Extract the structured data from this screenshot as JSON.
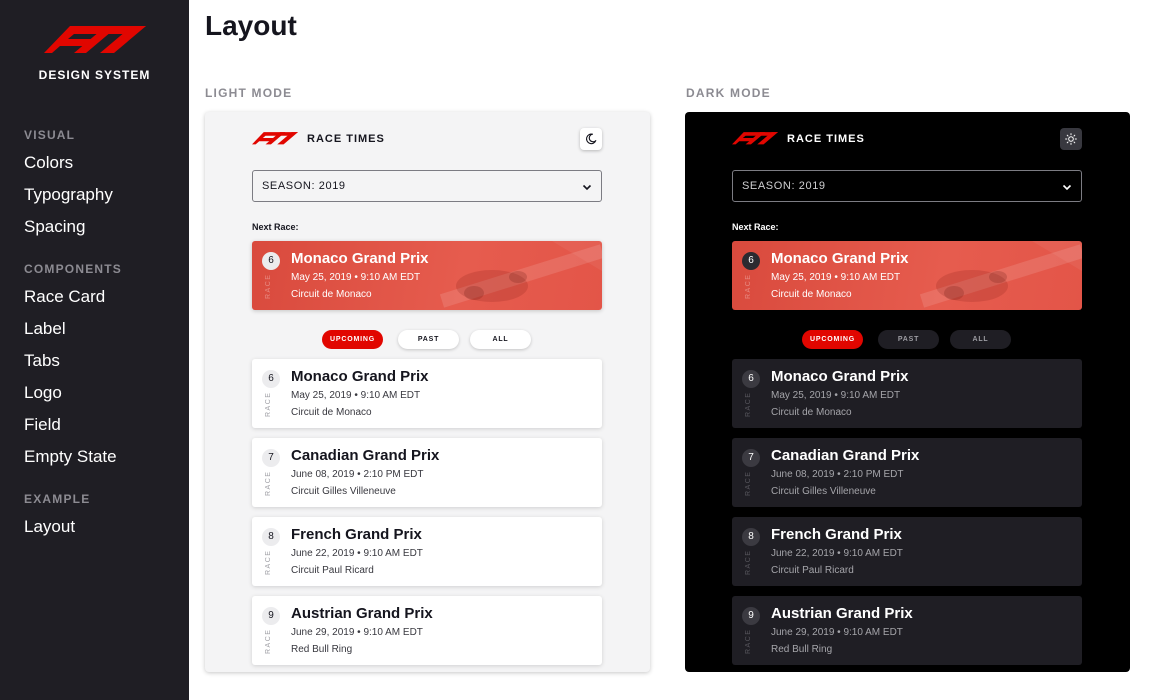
{
  "sidebar": {
    "brand": "DESIGN SYSTEM",
    "sections": [
      {
        "title": "VISUAL",
        "items": [
          "Colors",
          "Typography",
          "Spacing"
        ]
      },
      {
        "title": "COMPONENTS",
        "items": [
          "Race Card",
          "Label",
          "Tabs",
          "Logo",
          "Field",
          "Empty State"
        ]
      },
      {
        "title": "EXAMPLE",
        "items": [
          "Layout"
        ]
      }
    ]
  },
  "page": {
    "title": "Layout",
    "light_label": "LIGHT MODE",
    "dark_label": "DARK MODE"
  },
  "app": {
    "header_title": "RACE TIMES",
    "season_value": "SEASON: 2019",
    "next_race_label": "Next Race:",
    "race_tag": "RACE",
    "tabs": [
      "UPCOMING",
      "PAST",
      "ALL"
    ],
    "active_tab": "UPCOMING",
    "next_race": {
      "round": "6",
      "name": "Monaco Grand Prix",
      "date": "May 25, 2019 • 9:10 AM EDT",
      "circuit": "Circuit de Monaco"
    },
    "races": [
      {
        "round": "6",
        "name": "Monaco Grand Prix",
        "date": "May 25, 2019 • 9:10 AM EDT",
        "circuit": "Circuit de Monaco"
      },
      {
        "round": "7",
        "name": "Canadian Grand Prix",
        "date": "June 08, 2019 • 2:10 PM EDT",
        "circuit": "Circuit Gilles Villeneuve"
      },
      {
        "round": "8",
        "name": "French Grand Prix",
        "date": "June 22, 2019 • 9:10 AM EDT",
        "circuit": "Circuit Paul Ricard"
      },
      {
        "round": "9",
        "name": "Austrian Grand Prix",
        "date": "June 29, 2019 • 9:10 AM EDT",
        "circuit": "Red Bull Ring"
      }
    ]
  },
  "colors": {
    "f1_red": "#e10600",
    "sidebar_bg": "#1f1e24",
    "light_panel_bg": "#f4f4f5",
    "dark_panel_bg": "#000000",
    "dark_card_bg": "#1f1e24"
  },
  "icons": {
    "light_toggle": "moon-icon",
    "dark_toggle": "sun-icon",
    "select": "chevron-down-icon"
  }
}
